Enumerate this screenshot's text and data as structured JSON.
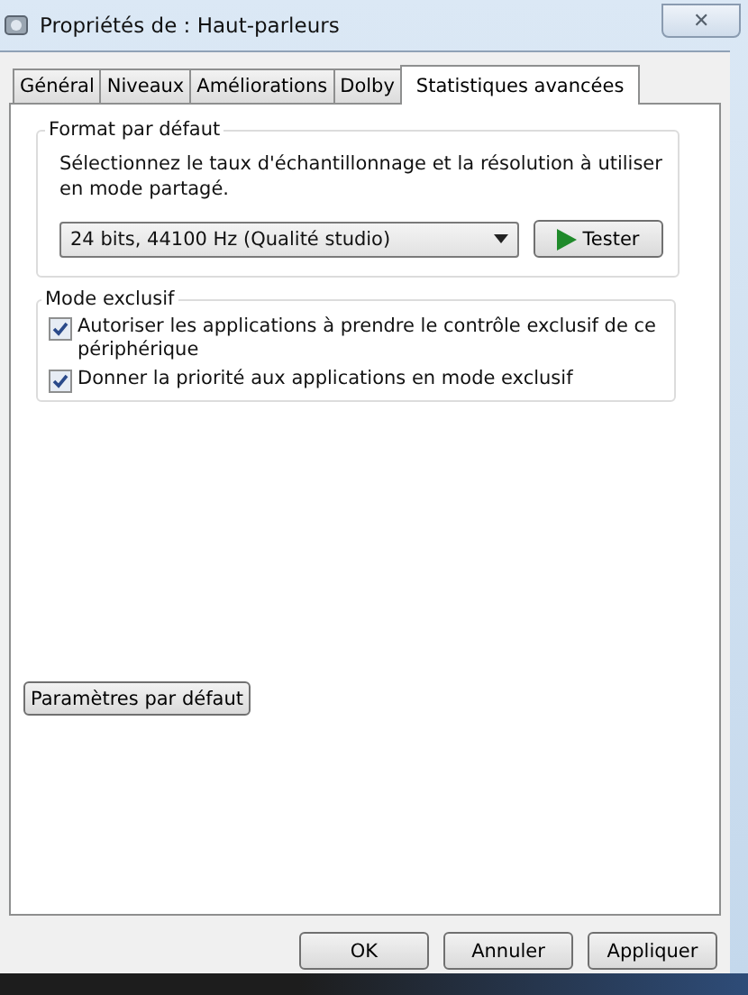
{
  "window": {
    "title": "Propriétés de : Haut-parleurs",
    "close": "✕"
  },
  "tabs": [
    {
      "label": "Général",
      "selected": false
    },
    {
      "label": "Niveaux",
      "selected": false
    },
    {
      "label": "Améliorations",
      "selected": false
    },
    {
      "label": "Dolby",
      "selected": false
    },
    {
      "label": "Statistiques avancées",
      "selected": true
    }
  ],
  "format_group": {
    "title": "Format par défaut",
    "description": "Sélectionnez le taux d'échantillonnage et la résolution à utiliser en mode partagé.",
    "format": "24 bits, 44100 Hz (Qualité studio)",
    "test_button": "Tester"
  },
  "exclusive_group": {
    "title": "Mode exclusif",
    "options": [
      {
        "label": "Autoriser les applications à prendre le contrôle exclusif de ce périphérique",
        "checked": true
      },
      {
        "label": "Donner la priorité aux applications en mode exclusif",
        "checked": true
      }
    ]
  },
  "default_button": "Paramètres par défaut",
  "buttons": [
    "OK",
    "Annuler",
    "Appliquer"
  ]
}
